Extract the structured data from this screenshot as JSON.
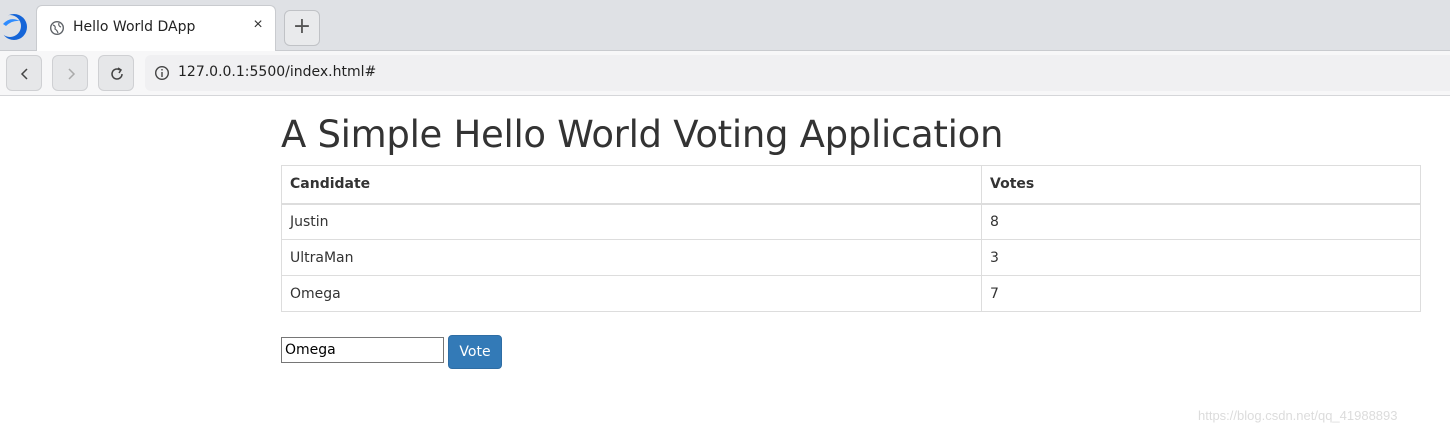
{
  "browser": {
    "tab_title": "Hello World DApp",
    "tab_close": "×",
    "new_tab": "+",
    "url": "127.0.0.1:5500/index.html#",
    "icons": {
      "logo": "browser-logo-icon",
      "favicon": "globe-icon",
      "back": "back-arrow-icon",
      "forward": "forward-arrow-icon",
      "reload": "reload-icon",
      "info": "info-icon"
    }
  },
  "page": {
    "title": "A Simple Hello World Voting Application",
    "table": {
      "headers": [
        "Candidate",
        "Votes"
      ],
      "rows": [
        {
          "candidate": "Justin",
          "votes": "8"
        },
        {
          "candidate": "UltraMan",
          "votes": "3"
        },
        {
          "candidate": "Omega",
          "votes": "7"
        }
      ]
    },
    "input_value": "Omega",
    "vote_button_label": "Vote",
    "accent_color": "#337ab7"
  },
  "watermark": "https://blog.csdn.net/qq_41988893"
}
